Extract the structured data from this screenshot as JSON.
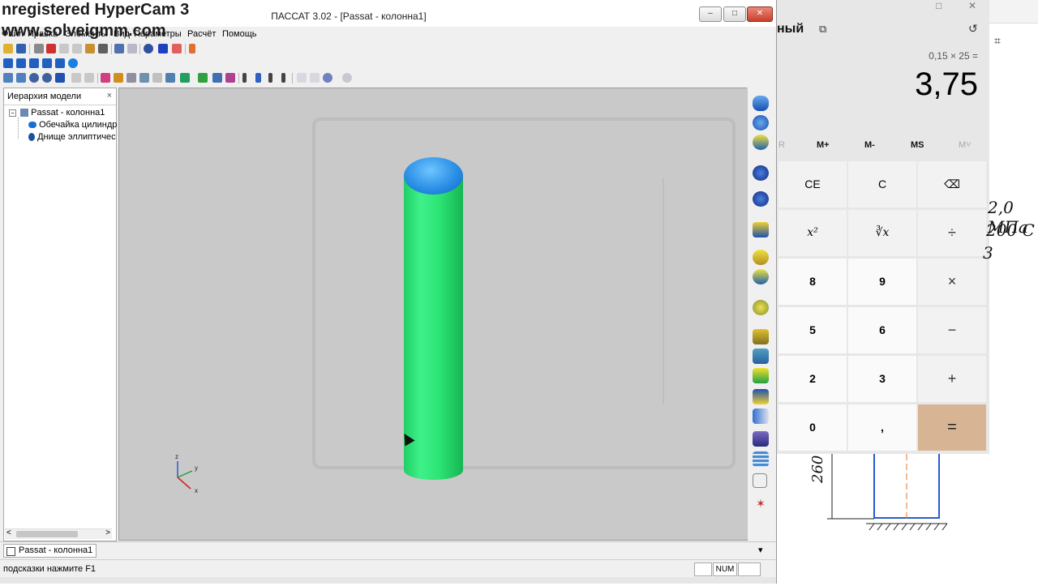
{
  "watermark": {
    "line1": "nregistered HyperCam 3",
    "line2": "www.solveigmm.com"
  },
  "passat": {
    "window_title": "ПАССАТ 3.02 - [Passat - колонна1]",
    "window_buttons": {
      "minimize": "–",
      "maximize": "□",
      "close": "✕"
    },
    "menu": [
      "Файл",
      "Правка",
      "Элементы",
      "Вид",
      "Параметры",
      "Расчёт",
      "Помощь"
    ],
    "hierarchy": {
      "title": "Иерархия модели",
      "close": "×",
      "root": "Passat - колонна1",
      "children": [
        "Обечайка цилиндр",
        "Днище эллиптичес"
      ],
      "scroll_left": "<",
      "scroll_right": ">"
    },
    "axes": {
      "z": "z",
      "y": "y",
      "x": "x"
    },
    "tab": "Passat - колонна1",
    "tab_dropdown": "▾",
    "status_hint": "подсказки нажмите F1",
    "status_num": "NUM",
    "colors": {
      "shell": "#2ce475",
      "head": "#2a8fe6",
      "viewport": "#c9c9c9"
    }
  },
  "calculator": {
    "mode": "ный",
    "keep_on_top_icon": "keep-on-top-icon",
    "history_icon": "history-icon",
    "expression": "0,15 × 25 =",
    "result": "3,75",
    "memory": [
      "R",
      "M+",
      "M-",
      "MS",
      "M˅"
    ],
    "keys": {
      "ce": "CE",
      "c": "C",
      "backspace": "⌫",
      "square": "x²",
      "cuberoot": "∛x",
      "divide": "÷",
      "k8": "8",
      "k9": "9",
      "multiply": "×",
      "k5": "5",
      "k6": "6",
      "minus": "−",
      "k2": "2",
      "k3": "3",
      "plus": "+",
      "k0": "0",
      "comma": ",",
      "equals": "="
    },
    "colors": {
      "equals": "#d7b493",
      "background": "#e7e7e7"
    }
  },
  "drawing": {
    "text1": "2,0 МПа",
    "text2": "200 С",
    "text3": "3",
    "dim": "260"
  }
}
